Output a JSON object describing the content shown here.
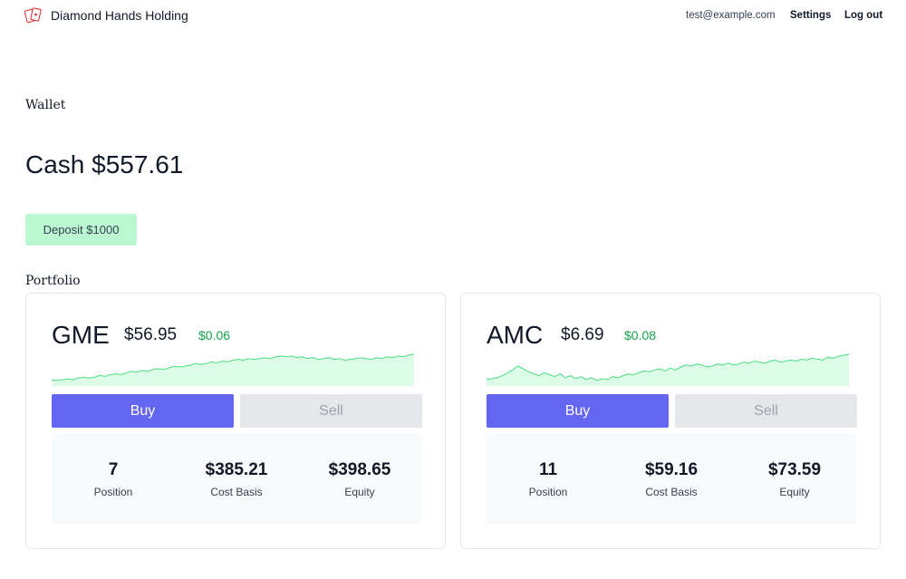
{
  "nav": {
    "brand": "Diamond Hands Holding",
    "email": "test@example.com",
    "settings_label": "Settings",
    "logout_label": "Log out"
  },
  "wallet": {
    "heading": "Wallet",
    "cash_text": "Cash $557.61",
    "deposit_label": "Deposit $1000"
  },
  "portfolio": {
    "heading": "Portfolio",
    "holdings": [
      {
        "ticker": "GME",
        "price": "$56.95",
        "change": "$0.06",
        "buy_label": "Buy",
        "sell_label": "Sell",
        "position": "7",
        "position_label": "Position",
        "cost_basis": "$385.21",
        "cost_basis_label": "Cost Basis",
        "equity": "$398.65",
        "equity_label": "Equity",
        "sparkline": [
          30,
          31,
          30,
          29,
          30,
          28,
          27,
          28,
          27,
          25,
          26,
          24,
          23,
          24,
          22,
          20,
          21,
          19,
          20,
          18,
          17,
          18,
          16,
          14,
          15,
          14,
          13,
          11,
          12,
          11,
          9,
          10,
          8,
          9,
          7,
          6,
          7,
          5,
          6,
          5,
          4,
          5,
          3,
          2,
          3,
          2,
          4,
          3,
          5,
          4,
          6,
          5,
          4,
          6,
          5,
          7,
          6,
          5,
          4,
          5,
          6,
          4,
          5,
          3,
          4,
          2,
          3,
          1,
          0
        ],
        "colors": {
          "line": "#4ade80",
          "fill": "#dcfce7"
        }
      },
      {
        "ticker": "AMC",
        "price": "$6.69",
        "change": "$0.08",
        "buy_label": "Buy",
        "sell_label": "Sell",
        "position": "11",
        "position_label": "Position",
        "cost_basis": "$59.16",
        "cost_basis_label": "Cost Basis",
        "equity": "$73.59",
        "equity_label": "Equity",
        "sparkline": [
          28,
          27,
          26,
          24,
          21,
          18,
          14,
          17,
          20,
          22,
          24,
          21,
          23,
          25,
          22,
          26,
          24,
          27,
          25,
          28,
          26,
          29,
          27,
          28,
          25,
          26,
          24,
          22,
          23,
          21,
          19,
          20,
          18,
          17,
          19,
          16,
          18,
          15,
          13,
          14,
          12,
          13,
          15,
          14,
          12,
          13,
          11,
          13,
          12,
          10,
          11,
          9,
          10,
          11,
          9,
          8,
          10,
          9,
          8,
          9,
          7,
          8,
          6,
          7,
          8,
          5,
          6,
          4,
          3,
          2
        ],
        "colors": {
          "line": "#4ade80",
          "fill": "#dcfce7"
        }
      }
    ]
  }
}
